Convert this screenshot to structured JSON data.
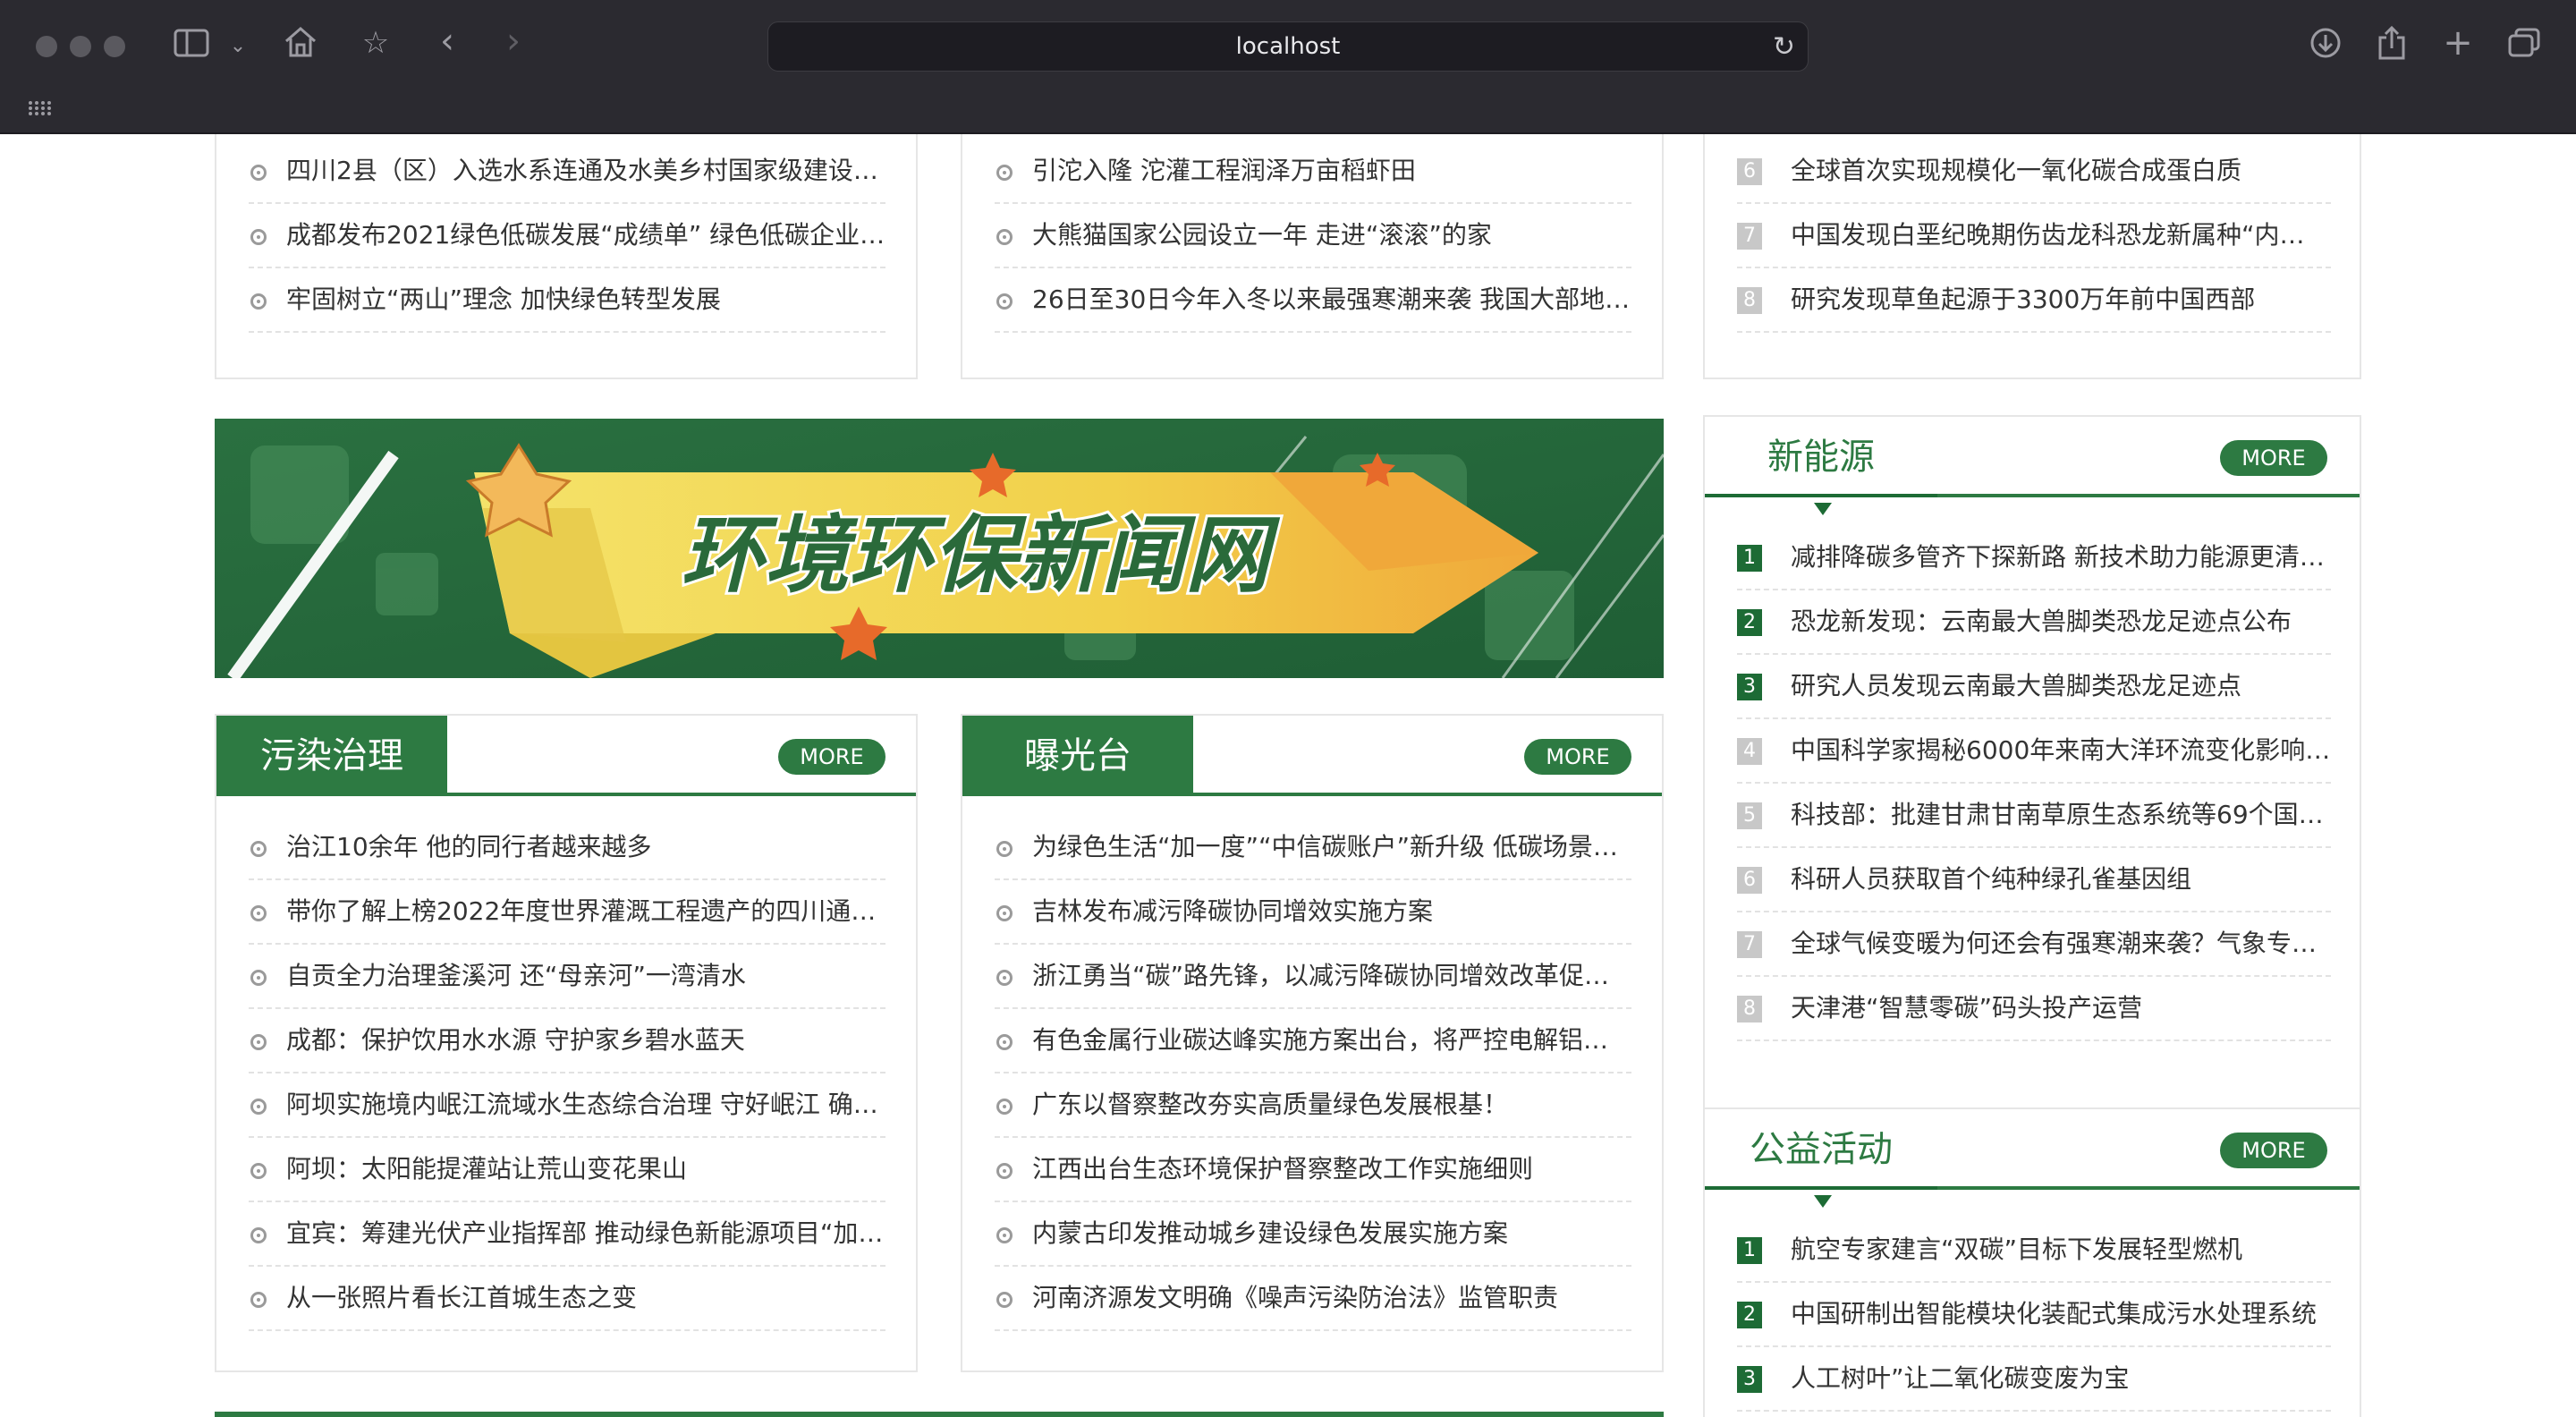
{
  "browser": {
    "address": "localhost"
  },
  "top_left_list": [
    "四川2县（区）入选水系连通及水美乡村国家级建设…",
    "成都发布2021绿色低碳发展“成绩单” 绿色低碳企业…",
    "牢固树立“两山”理念 加快绿色转型发展"
  ],
  "top_mid_list": [
    "引沱入隆 沱灌工程润泽万亩稻虾田",
    "大熊猫国家公园设立一年 走进“滚滚”的家",
    "26日至30日今年入冬以来最强寒潮来袭 我国大部地…"
  ],
  "top_right_list": [
    {
      "n": "6",
      "t": "全球首次实现规模化一氧化碳合成蛋白质"
    },
    {
      "n": "7",
      "t": "中国发现白垩纪晚期伤齿龙科恐龙新属种“内…"
    },
    {
      "n": "8",
      "t": "研究发现草鱼起源于3300万年前中国西部"
    }
  ],
  "banner": {
    "title": "环境环保新闻网"
  },
  "pollution": {
    "title": "污染治理",
    "more": "MORE",
    "items": [
      "治江10余年 他的同行者越来越多",
      "带你了解上榜2022年度世界灌溉工程遗产的四川通…",
      "自贡全力治理釜溪河 还“母亲河”一湾清水",
      "成都：保护饮用水水源 守护家乡碧水蓝天",
      "阿坝实施境内岷江流域水生态综合治理 守好岷江 确…",
      "阿坝：太阳能提灌站让荒山变花果山",
      "宜宾：筹建光伏产业指挥部 推动绿色新能源项目“加…",
      "从一张照片看长江首城生态之变"
    ]
  },
  "exposure": {
    "title": "曝光台",
    "more": "MORE",
    "items": [
      "为绿色生活“加一度”“中信碳账户”新升级 低碳场景…",
      "吉林发布减污降碳协同增效实施方案",
      "浙江勇当“碳”路先锋，以减污降碳协同增效改革促…",
      "有色金属行业碳达峰实施方案出台，将严控电解铝…",
      "广东以督察整改夯实高质量绿色发展根基！",
      "江西出台生态环境保护督察整改工作实施细则",
      "内蒙古印发推动城乡建设绿色发展实施方案",
      "河南济源发文明确《噪声污染防治法》监管职责"
    ]
  },
  "new_energy": {
    "title": "新能源",
    "more": "MORE",
    "items": [
      {
        "n": "1",
        "t": "减排降碳多管齐下探新路 新技术助力能源更清…"
      },
      {
        "n": "2",
        "t": "恐龙新发现：云南最大兽脚类恐龙足迹点公布"
      },
      {
        "n": "3",
        "t": "研究人员发现云南最大兽脚类恐龙足迹点"
      },
      {
        "n": "4",
        "t": "中国科学家揭秘6000年来南大洋环流变化影响…"
      },
      {
        "n": "5",
        "t": "科技部：批建甘肃甘南草原生态系统等69个国…"
      },
      {
        "n": "6",
        "t": "科研人员获取首个纯种绿孔雀基因组"
      },
      {
        "n": "7",
        "t": "全球气候变暖为何还会有强寒潮来袭？气象专…"
      },
      {
        "n": "8",
        "t": "天津港“智慧零碳”码头投产运营"
      }
    ]
  },
  "charity": {
    "title": "公益活动",
    "more": "MORE",
    "items": [
      {
        "n": "1",
        "t": "航空专家建言“双碳”目标下发展轻型燃机"
      },
      {
        "n": "2",
        "t": "中国研制出智能模块化装配式集成污水处理系统"
      },
      {
        "n": "3",
        "t": "人工树叶”让二氧化碳变废为宝"
      }
    ]
  },
  "colors": {
    "brand_green": "#2d7a42",
    "dark_green": "#1d6b35",
    "chrome_bg": "#2b2a30"
  }
}
